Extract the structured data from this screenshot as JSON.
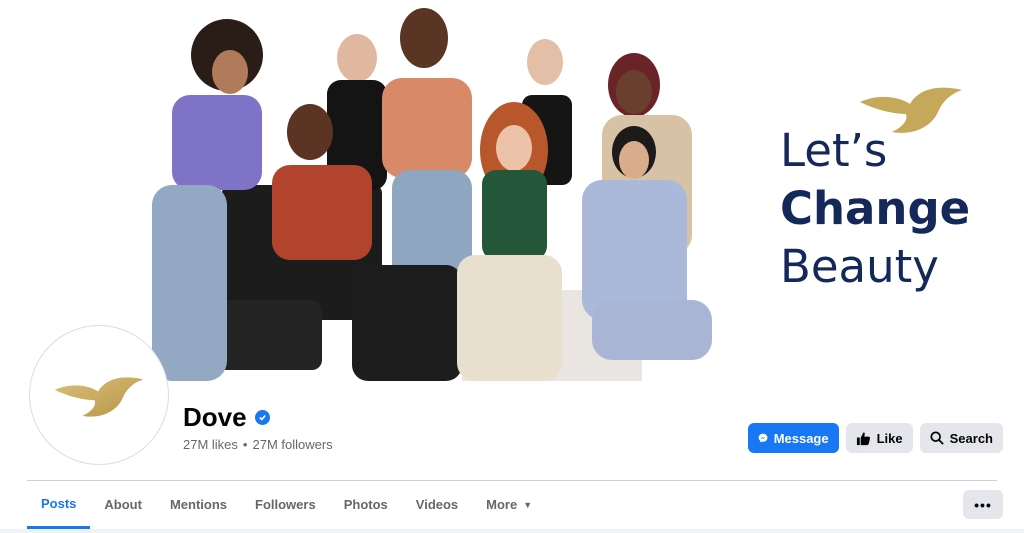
{
  "cover": {
    "tagline_line1": "Let’s",
    "tagline_line2": "Change",
    "tagline_line3": "Beauty",
    "logo_icon": "dove-bird-icon",
    "colors": {
      "tagline": "#14285a",
      "gold": "#c5a85a"
    }
  },
  "profile": {
    "name": "Dove",
    "verified_icon": "verified-badge-icon",
    "likes": "27M likes",
    "separator": "•",
    "followers": "27M followers"
  },
  "actions": {
    "message_label": "Message",
    "like_label": "Like",
    "search_label": "Search"
  },
  "tabs": [
    {
      "label": "Posts"
    },
    {
      "label": "About"
    },
    {
      "label": "Mentions"
    },
    {
      "label": "Followers"
    },
    {
      "label": "Photos"
    },
    {
      "label": "Videos"
    },
    {
      "label": "More"
    }
  ],
  "overflow_menu_label": "•••",
  "colors": {
    "accent": "#1877f2",
    "button_gray": "#e4e6eb",
    "muted_text": "#65676b"
  }
}
